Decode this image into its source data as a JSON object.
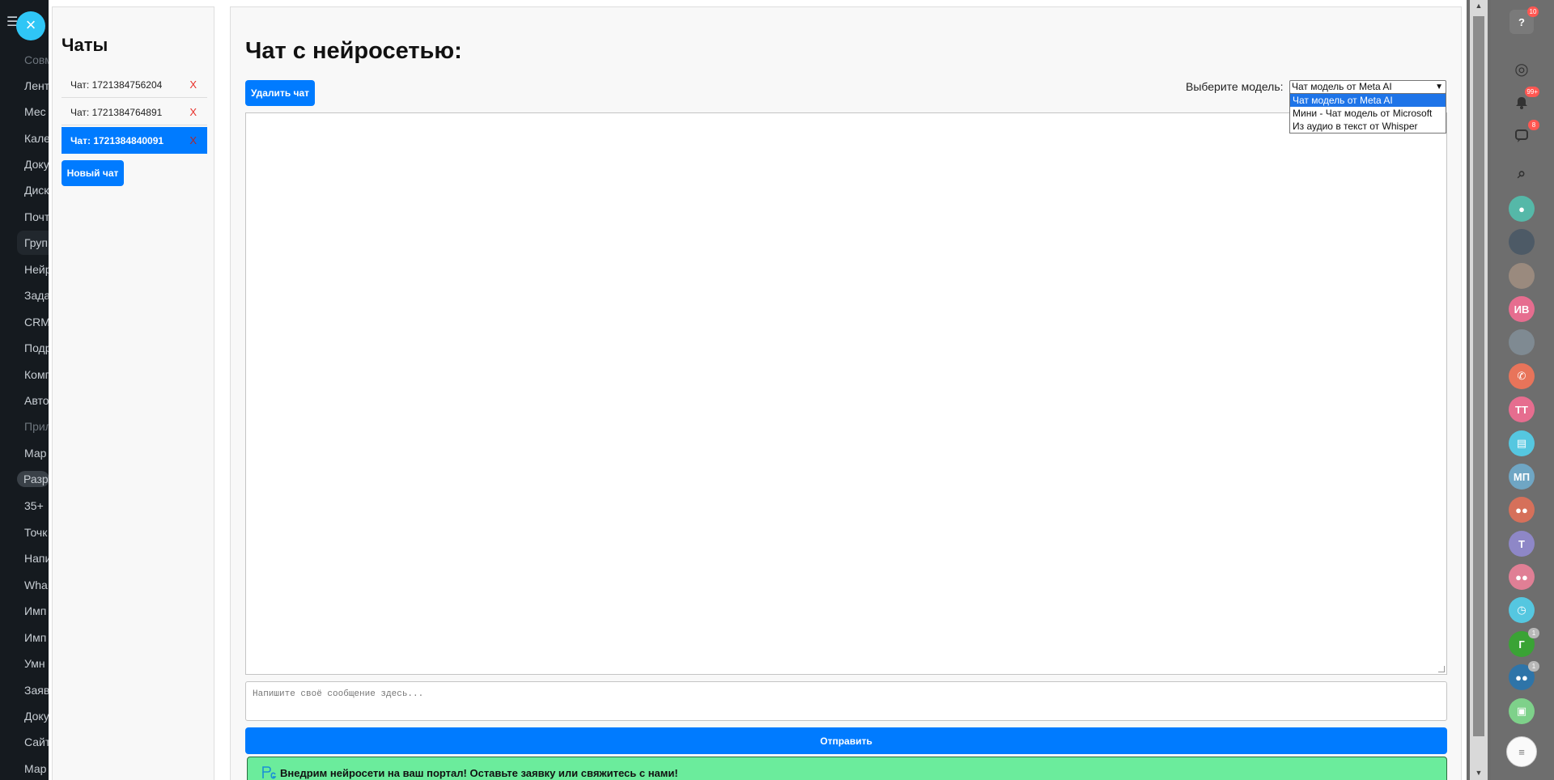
{
  "modal": {
    "close_label": "×"
  },
  "sidebar": {
    "title": "Чаты",
    "chats": [
      {
        "label": "Чат: 1721384756204",
        "delete_label": "X",
        "active": false
      },
      {
        "label": "Чат: 1721384764891",
        "delete_label": "X",
        "active": false
      },
      {
        "label": "Чат: 1721384840091",
        "delete_label": "X",
        "active": true
      }
    ],
    "new_chat_label": "Новый чат"
  },
  "main": {
    "title": "Чат с нейросетью:",
    "delete_chat_label": "Удалить чат",
    "model_label": "Выберите модель:",
    "model_selected": "Чат модель от Meta AI",
    "model_options": [
      "Чат модель от Meta AI",
      "Мини - Чат модель от Microsoft",
      "Из аудио в текст от Whisper"
    ],
    "message_placeholder": "Напишите своё сообщение здесь...",
    "send_label": "Отправить",
    "promo_text": "Внедрим нейросети на ваш портал! Оставьте заявку или свяжитесь с нами!"
  },
  "background": {
    "left_nav": [
      "Совм",
      "Лент",
      "Мес",
      "Кале",
      "Доку",
      "Диск",
      "Почт",
      "Груп",
      "Нейр",
      "Зада",
      "CRM",
      "Подр",
      "Комп",
      "Авто",
      "Прил",
      "Мар",
      "Разр",
      "35+",
      "Точк",
      "Напи",
      "Wha",
      "Имп",
      "Имп",
      "Умн",
      "Заяв",
      "Доку",
      "Сайт",
      "Мар"
    ],
    "right_badges": {
      "help": "10",
      "notifications": "99+",
      "messages": "8",
      "chat_g": "1",
      "chat_group": "1"
    },
    "avatar_initials": {
      "iv": "ИВ",
      "tt": "ТТ",
      "mp": "МП",
      "t": "Т",
      "g": "Г"
    }
  },
  "colors": {
    "accent": "#007bff",
    "promo": "#6bec9c",
    "close": "#2fc6f6",
    "delete": "#e8302a"
  }
}
